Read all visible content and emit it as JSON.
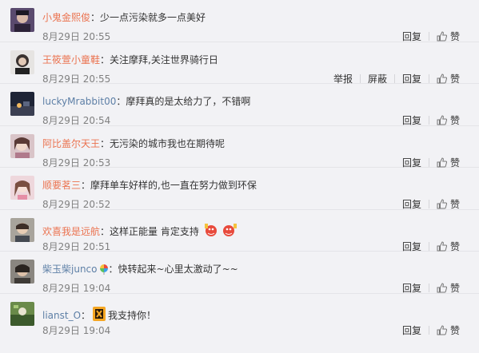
{
  "actions": {
    "report": "举报",
    "block": "屏蔽",
    "reply": "回复",
    "like": "赞"
  },
  "comments": [
    {
      "user": "小鬼金熙俊",
      "text": "少一点污染就多一点美好",
      "time": "8月29日 20:55"
    },
    {
      "user": "王筱萱小童鞋",
      "text": "关注摩拜,关注世界骑行日",
      "time": "8月29日 20:55"
    },
    {
      "user": "luckyMrabbit00",
      "text": "摩拜真的是太给力了，不错啊",
      "time": "8月29日 20:54"
    },
    {
      "user": "阿比盖尔天王",
      "text": "无污染的城市我也在期待呢",
      "time": "8月29日 20:53"
    },
    {
      "user": "顺要茗三",
      "text": "摩拜单车好样的,也一直在努力做到环保",
      "time": "8月29日 20:52"
    },
    {
      "user": "欢喜我是远航",
      "text": "这样正能量 肯定支持",
      "time": "8月29日 20:51"
    },
    {
      "user": "柴玉柴junco",
      "text": "快转起来~心里太激动了~~",
      "time": "8月29日 19:04"
    },
    {
      "user": "lianst_O",
      "text": "我支持你！",
      "time": "8月29日 19:04"
    }
  ]
}
